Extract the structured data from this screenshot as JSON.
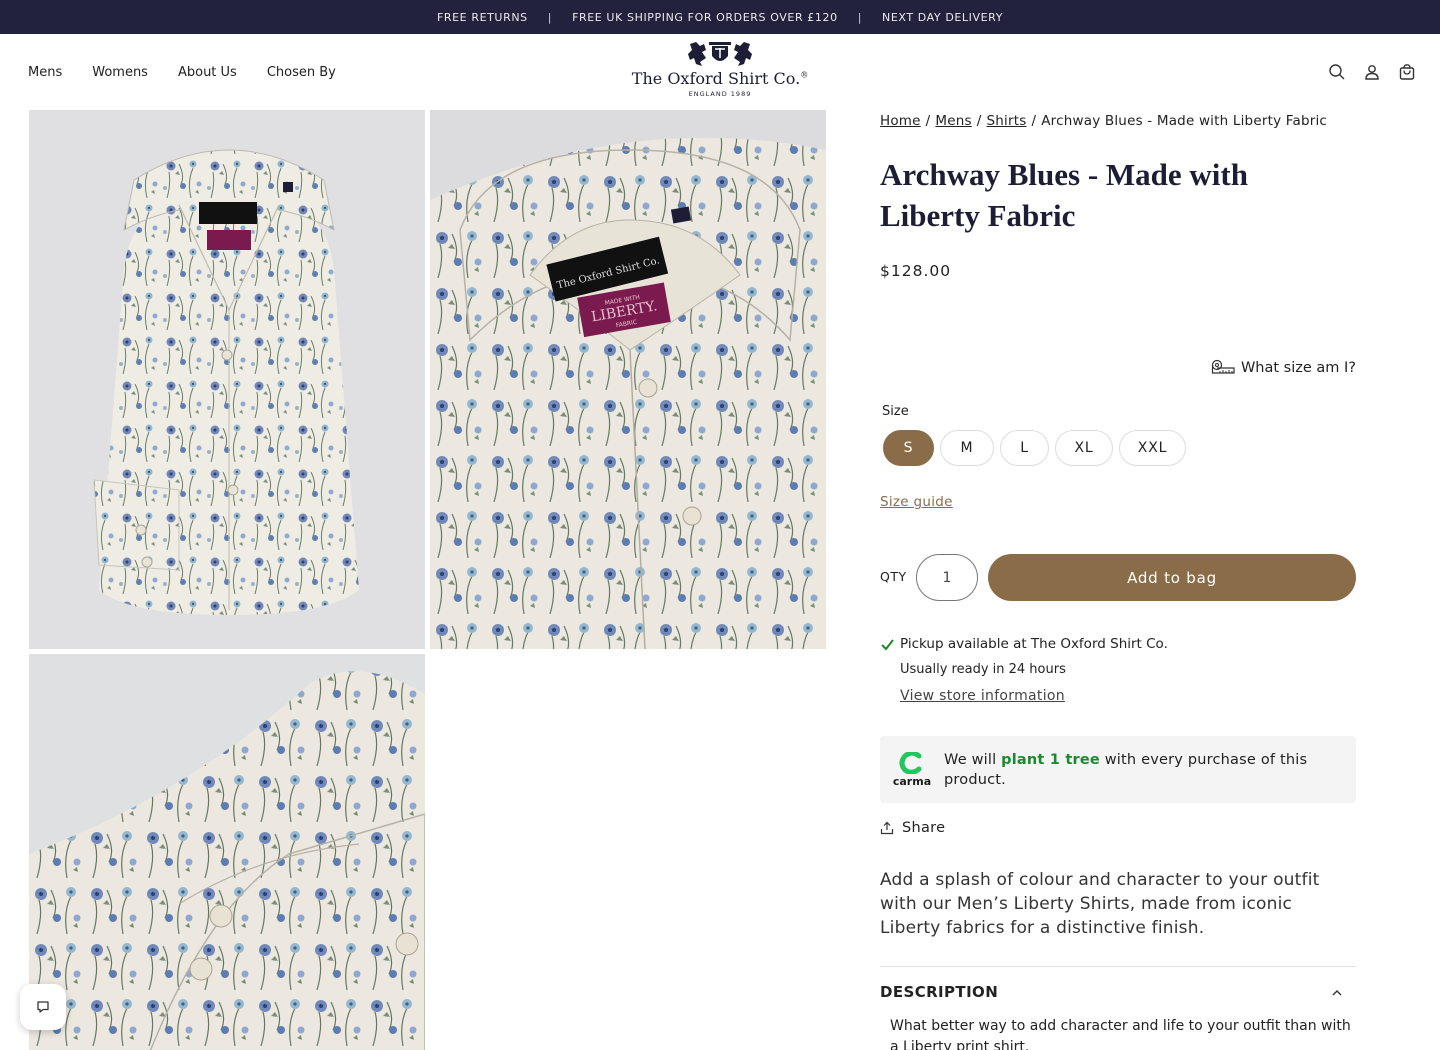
{
  "announcement": {
    "items": [
      "FREE RETURNS",
      "FREE UK SHIPPING FOR ORDERS OVER £120",
      "NEXT DAY DELIVERY"
    ],
    "separator": "|"
  },
  "nav": {
    "items": [
      "Mens",
      "Womens",
      "About Us",
      "Chosen By"
    ]
  },
  "logo": {
    "name": "The Oxford Shirt Co.",
    "registered": "®",
    "est": "ENGLAND 1989"
  },
  "header_icons": [
    "search-icon",
    "account-icon",
    "bag-icon"
  ],
  "gallery": {
    "label_brand": "The Oxford Shirt Co.",
    "label_liberty": "LIBERTY.",
    "label_made": "MADE WITH",
    "label_fabric": "FABRIC"
  },
  "breadcrumb": {
    "links": [
      "Home",
      "Mens",
      "Shirts"
    ],
    "current": "Archway Blues - Made with Liberty Fabric",
    "separator": "/"
  },
  "product": {
    "title_line1": "Archway Blues - Made with",
    "title_line2": "Liberty Fabric",
    "price": "$128.00",
    "size_help": "What size am I?",
    "size_label": "Size",
    "sizes": [
      "S",
      "M",
      "L",
      "XL",
      "XXL"
    ],
    "selected_size": "S",
    "size_guide": "Size guide",
    "qty_label": "QTY",
    "qty_value": "1",
    "add_to_bag": "Add to bag"
  },
  "pickup": {
    "available_text": "Pickup available at The Oxford Shirt Co.",
    "ready_text": "Usually ready in 24 hours",
    "store_link": "View store information"
  },
  "carma": {
    "logo_text": "carma",
    "text_before": "We will ",
    "highlight": "plant 1 tree",
    "text_after": " with every purchase of this product."
  },
  "share": {
    "label": "Share"
  },
  "blurb": "Add a splash of colour and character to your outfit with our Men’s Liberty Shirts, made from iconic Liberty fabrics for a distinctive finish.",
  "description": {
    "heading": "DESCRIPTION",
    "body": "What better way to add character and life to your outfit than with a Liberty print shirt."
  },
  "colors": {
    "announcement_bg": "#23223d",
    "brand_navy": "#1d1d35",
    "accent_brown": "#8a6c48",
    "carma_green": "#1b8a2c",
    "liberty_purple": "#7b1a4e"
  }
}
